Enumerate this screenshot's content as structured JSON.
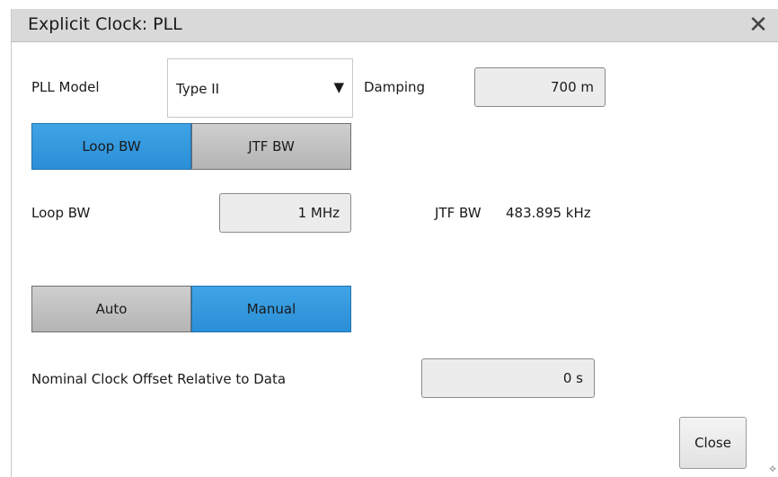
{
  "dialog": {
    "title": "Explicit Clock: PLL",
    "close_icon": "close-icon"
  },
  "pll_model": {
    "label": "PLL Model",
    "selected": "Type II",
    "arrow": "▼"
  },
  "damping": {
    "label": "Damping",
    "value": "700 m"
  },
  "bw_mode": {
    "options": [
      "Loop BW",
      "JTF BW"
    ],
    "selected": "Loop BW"
  },
  "loop_bw": {
    "label": "Loop BW",
    "value": "1 MHz"
  },
  "jtf_bw": {
    "label": "JTF BW",
    "value": "483.895 kHz"
  },
  "offset_mode": {
    "options": [
      "Auto",
      "Manual"
    ],
    "selected": "Manual"
  },
  "nominal_offset": {
    "label": "Nominal Clock Offset Relative to Data",
    "value": "0 s"
  },
  "footer": {
    "close_label": "Close"
  }
}
